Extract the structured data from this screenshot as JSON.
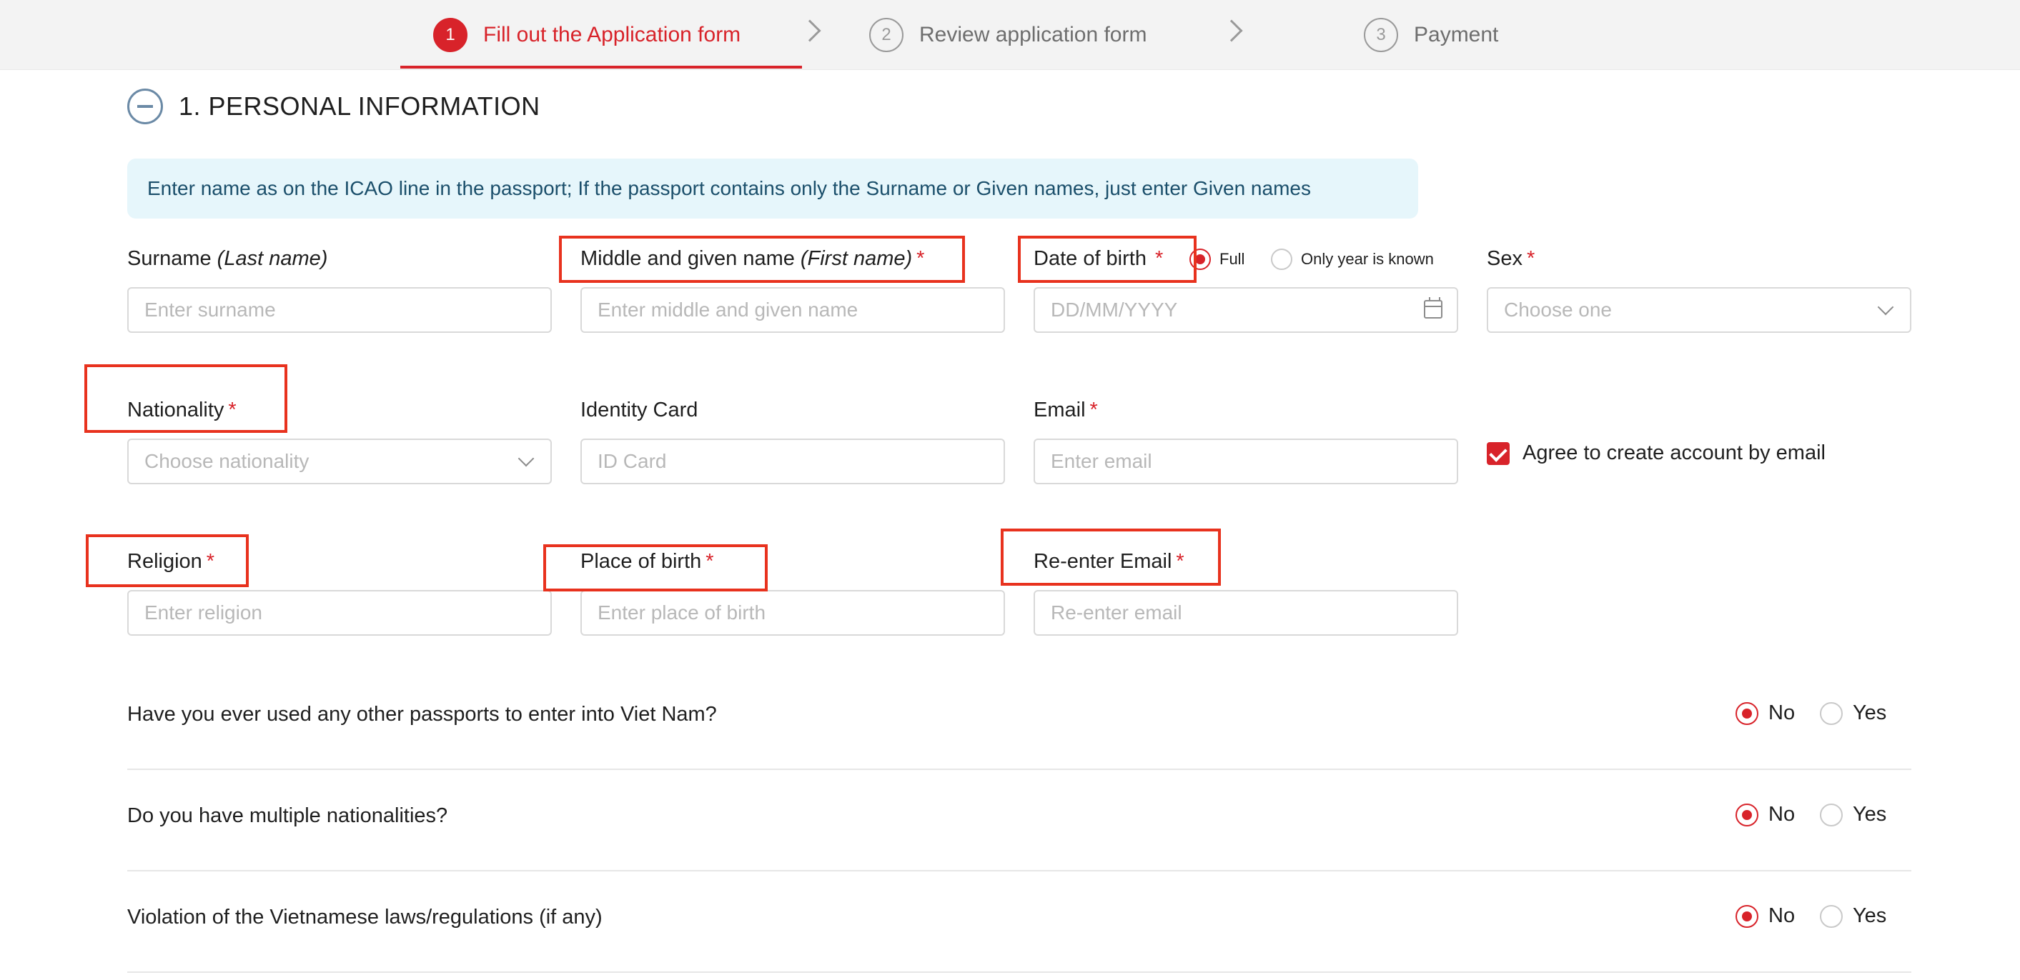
{
  "stepper": {
    "steps": [
      {
        "num": "1",
        "label": "Fill out the Application form"
      },
      {
        "num": "2",
        "label": "Review application form"
      },
      {
        "num": "3",
        "label": "Payment"
      }
    ]
  },
  "section": {
    "title": "1. PERSONAL INFORMATION"
  },
  "notice": "Enter name as on the ICAO line in the passport; If the passport contains only the Surname or Given names, just enter Given names",
  "fields": {
    "surname": {
      "label": "Surname",
      "hint": "(Last name)",
      "placeholder": "Enter surname"
    },
    "given_name": {
      "label": "Middle and given name",
      "hint": "(First name)",
      "required": "*",
      "placeholder": "Enter middle and given name"
    },
    "dob": {
      "label": "Date of birth",
      "required": "*",
      "placeholder": "DD/MM/YYYY",
      "option_full": "Full",
      "option_year": "Only year is known"
    },
    "sex": {
      "label": "Sex",
      "required": "*",
      "placeholder": "Choose one"
    },
    "nationality": {
      "label": "Nationality",
      "required": "*",
      "placeholder": "Choose nationality"
    },
    "identity_card": {
      "label": "Identity Card",
      "placeholder": "ID Card"
    },
    "email": {
      "label": "Email",
      "required": "*",
      "placeholder": "Enter email"
    },
    "agree": {
      "label": "Agree to create account by email"
    },
    "religion": {
      "label": "Religion",
      "required": "*",
      "placeholder": "Enter religion"
    },
    "place_of_birth": {
      "label": "Place of birth",
      "required": "*",
      "placeholder": "Enter place of birth"
    },
    "reenter_email": {
      "label": "Re-enter Email",
      "required": "*",
      "placeholder": "Re-enter email"
    }
  },
  "questions": [
    {
      "text": "Have you ever used any other passports to enter into Viet Nam?",
      "no": "No",
      "yes": "Yes"
    },
    {
      "text": "Do you have multiple nationalities?",
      "no": "No",
      "yes": "Yes"
    },
    {
      "text": "Violation of the Vietnamese laws/regulations (if any)",
      "no": "No",
      "yes": "Yes"
    }
  ],
  "colors": {
    "accent": "#d8232a",
    "highlight": "#e8321e",
    "notice_bg": "#e6f6fb"
  }
}
